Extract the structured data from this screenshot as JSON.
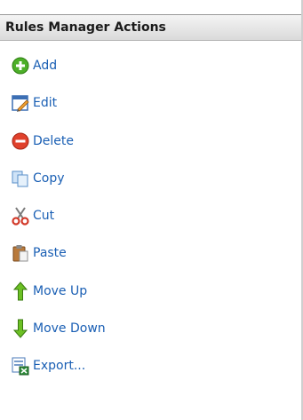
{
  "panel": {
    "title": "Rules Manager Actions"
  },
  "actions": [
    {
      "label": "Add",
      "icon": "add-icon"
    },
    {
      "label": "Edit",
      "icon": "edit-icon"
    },
    {
      "label": "Delete",
      "icon": "delete-icon"
    },
    {
      "label": "Copy",
      "icon": "copy-icon"
    },
    {
      "label": "Cut",
      "icon": "cut-icon"
    },
    {
      "label": "Paste",
      "icon": "paste-icon"
    },
    {
      "label": "Move Up",
      "icon": "move-up-icon"
    },
    {
      "label": "Move Down",
      "icon": "move-down-icon"
    },
    {
      "label": "Export...",
      "icon": "export-icon"
    }
  ],
  "colors": {
    "link": "#1a5fb4",
    "header_text": "#1b1b1b"
  }
}
